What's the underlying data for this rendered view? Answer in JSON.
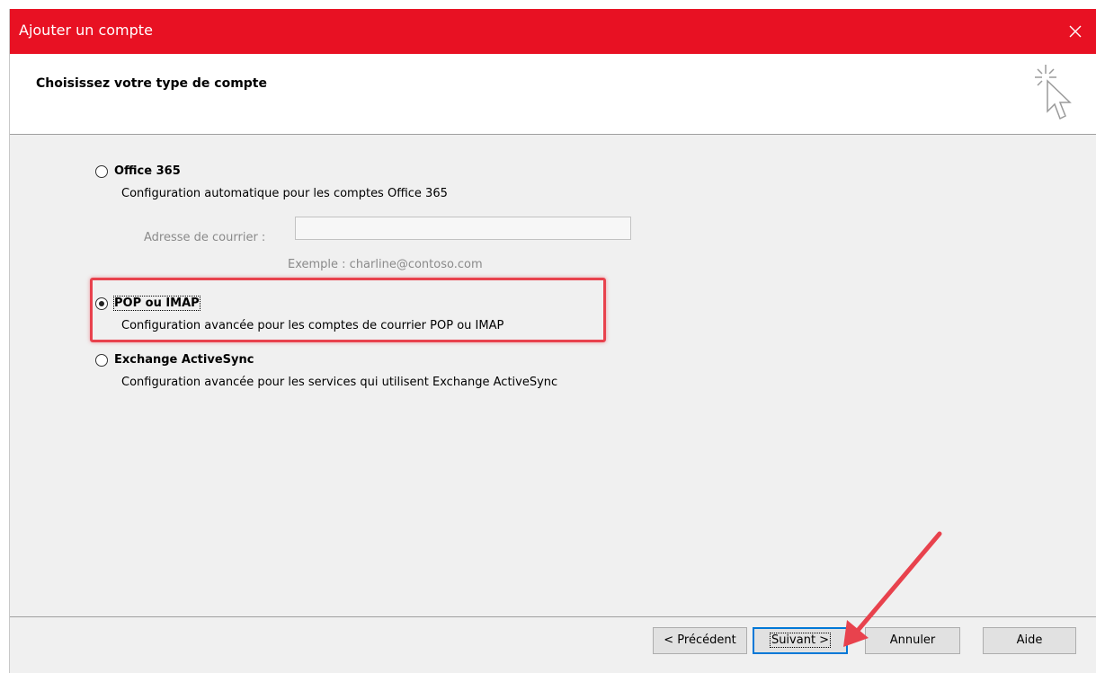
{
  "window": {
    "title": "Ajouter un compte"
  },
  "header": {
    "title": "Choisissez votre type de compte"
  },
  "options": [
    {
      "label": "Office 365",
      "description": "Configuration automatique pour les comptes Office 365",
      "selected": false
    },
    {
      "label": "POP ou IMAP",
      "description": "Configuration avancée pour les comptes de courrier POP ou IMAP",
      "selected": true
    },
    {
      "label": "Exchange ActiveSync",
      "description": "Configuration avancée pour les services qui utilisent Exchange ActiveSync",
      "selected": false
    }
  ],
  "email_field": {
    "label": "Adresse de courrier :",
    "value": "",
    "example": "Exemple : charline@contoso.com"
  },
  "buttons": {
    "previous": "< Précédent",
    "next": "Suivant >",
    "cancel": "Annuler",
    "help": "Aide"
  },
  "colors": {
    "titlebar": "#e81123",
    "highlight": "#e8424d",
    "default_button_border": "#0078d7"
  },
  "icons": {
    "close": "close-icon",
    "wizard": "wizard-cursor-icon"
  }
}
